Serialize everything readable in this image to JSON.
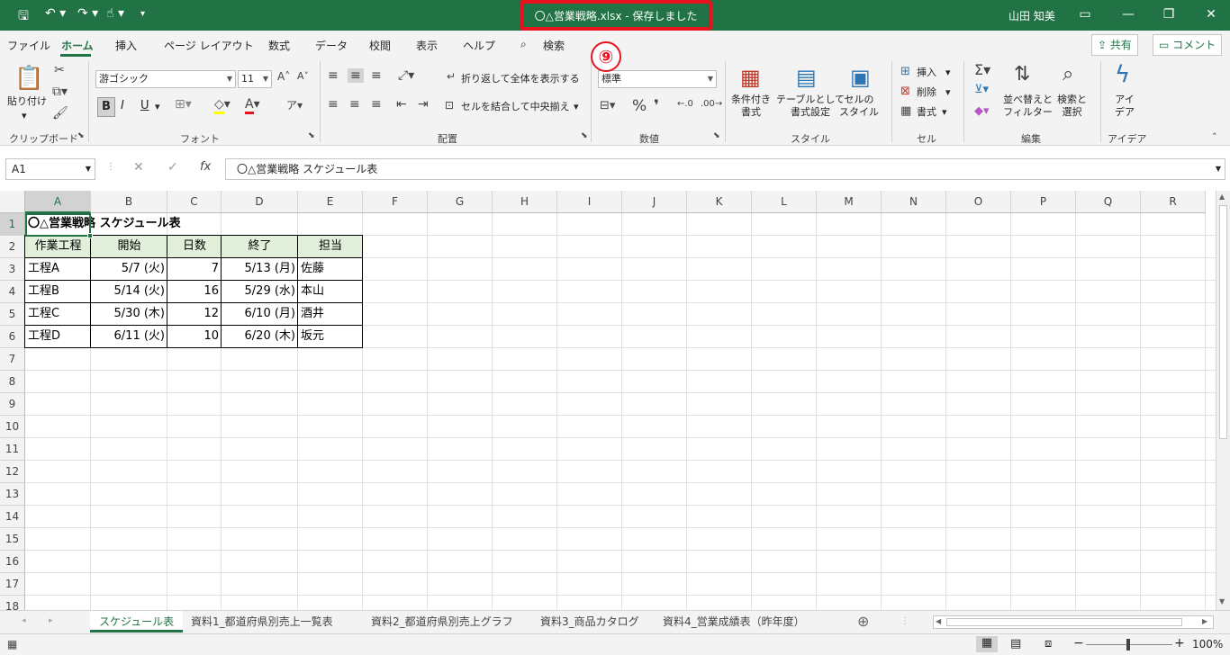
{
  "titlebar": {
    "title": "〇△営業戦略.xlsx  -  保存しました",
    "user": "山田 知美",
    "accent": "#217346",
    "highlight": "#e8121f"
  },
  "tabs": [
    "ファイル",
    "ホーム",
    "挿入",
    "ページ レイアウト",
    "数式",
    "データ",
    "校閲",
    "表示",
    "ヘルプ",
    "検索"
  ],
  "share_label": "共有",
  "comment_label": "コメント",
  "annotation_number": "⑨",
  "ribbon": {
    "clipboard": {
      "paste": "貼り付け",
      "label": "クリップボード"
    },
    "font": {
      "name": "游ゴシック",
      "size": "11",
      "bold": "B",
      "italic": "I",
      "underline": "U",
      "label": "フォント"
    },
    "alignment": {
      "wrap": "折り返して全体を表示する",
      "merge": "セルを結合して中央揃え",
      "label": "配置"
    },
    "number": {
      "format": "標準",
      "percent": "%",
      "comma": "❜",
      "label": "数値"
    },
    "styles": {
      "cond": "条件付き\n書式",
      "table": "テーブルとして\n書式設定",
      "cell": "セルの\nスタイル",
      "label": "スタイル"
    },
    "cells": {
      "insert": "挿入",
      "delete": "削除",
      "format": "書式",
      "label": "セル"
    },
    "editing": {
      "sort": "並べ替えと\nフィルター",
      "find": "検索と\n選択",
      "label": "編集"
    },
    "ideas": {
      "btn": "アイ\nデア",
      "label": "アイデア"
    }
  },
  "namebox": "A1",
  "formula": "〇△営業戦略 スケジュール表",
  "columns": [
    "A",
    "B",
    "C",
    "D",
    "E",
    "F",
    "G",
    "H",
    "I",
    "J",
    "K",
    "L",
    "M",
    "N",
    "O",
    "P",
    "Q",
    "R"
  ],
  "rows": [
    "1",
    "2",
    "3",
    "4",
    "5",
    "6",
    "7",
    "8",
    "9",
    "10",
    "11",
    "12",
    "13",
    "14",
    "15",
    "16",
    "17",
    "18"
  ],
  "table": {
    "title": "〇△営業戦略 スケジュール表",
    "headers": [
      "作業工程",
      "開始",
      "日数",
      "終了",
      "担当"
    ],
    "rows": [
      [
        "工程A",
        "5/7 (火)",
        "7",
        "5/13 (月)",
        "佐藤"
      ],
      [
        "工程B",
        "5/14 (火)",
        "16",
        "5/29 (水)",
        "本山"
      ],
      [
        "工程C",
        "5/30 (木)",
        "12",
        "6/10 (月)",
        "酒井"
      ],
      [
        "工程D",
        "6/11 (火)",
        "10",
        "6/20 (木)",
        "坂元"
      ]
    ]
  },
  "sheet_tabs": [
    "スケジュール表",
    "資料1_都道府県別売上一覧表",
    "資料2_都道府県別売上グラフ",
    "資料3_商品カタログ",
    "資料4_営業成績表（昨年度）"
  ],
  "zoom": "100%"
}
